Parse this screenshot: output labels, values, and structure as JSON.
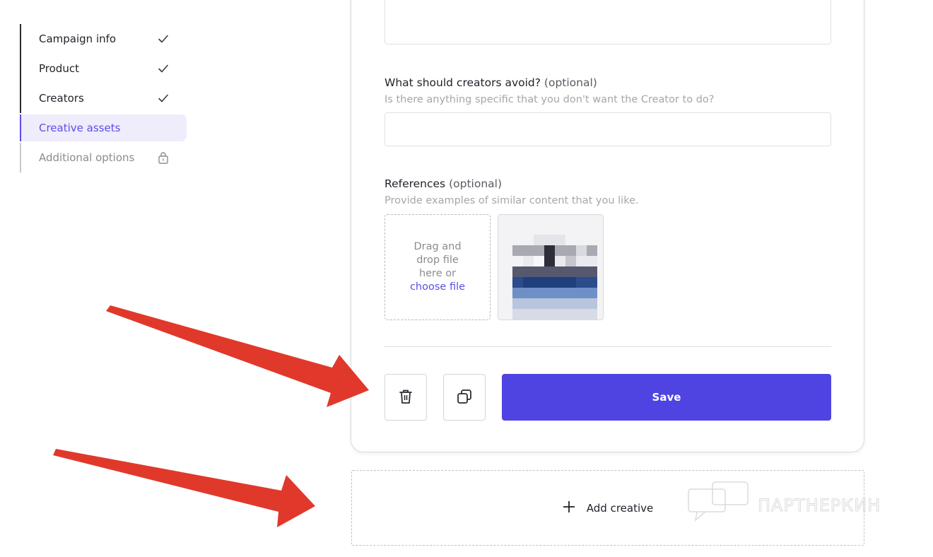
{
  "sidebar": {
    "steps": [
      {
        "label": "Campaign info",
        "state": "completed",
        "icon": "check-icon"
      },
      {
        "label": "Product",
        "state": "completed",
        "icon": "check-icon"
      },
      {
        "label": "Creators",
        "state": "completed",
        "icon": "check-icon"
      },
      {
        "label": "Creative assets",
        "state": "active",
        "icon": ""
      },
      {
        "label": "Additional options",
        "state": "locked",
        "icon": "lock-icon"
      }
    ]
  },
  "form": {
    "avoid": {
      "title": "What should creators avoid?",
      "optional": "(optional)",
      "hint": "Is there anything specific that you don't want the Creator to do?",
      "value": ""
    },
    "references": {
      "title": "References",
      "optional": "(optional)",
      "hint": "Provide examples of similar content that you like.",
      "dropzone_line1": "Drag and",
      "dropzone_line2": "drop file",
      "dropzone_line3": "here or",
      "dropzone_link": "choose file"
    },
    "actions": {
      "delete_icon": "trash-icon",
      "duplicate_icon": "copy-icon",
      "save_label": "Save"
    }
  },
  "add_creative": {
    "icon": "plus-icon",
    "label": "Add creative"
  },
  "watermark": {
    "text": "ПАРТНЕРКИН"
  },
  "colors": {
    "accent": "#4f43e2",
    "active_bg": "#efecfb",
    "annotation_arrow": "#e0392b"
  }
}
